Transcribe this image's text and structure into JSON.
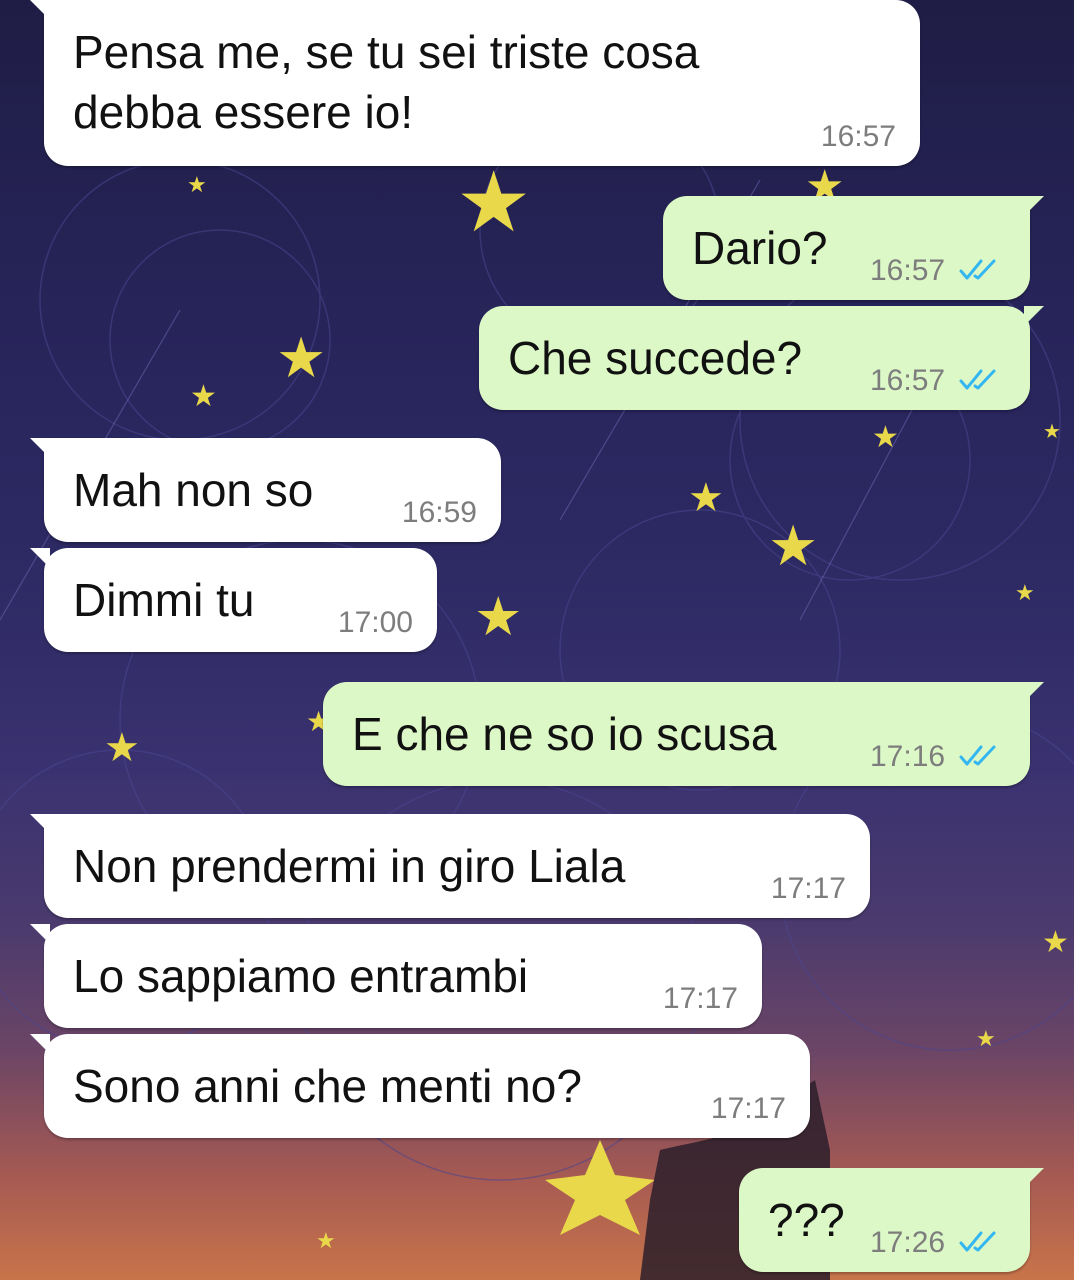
{
  "messages": [
    {
      "direction": "in",
      "text": "Pensa me, se tu sei triste cosa\ndebba essere io!",
      "time": "16:57"
    },
    {
      "direction": "out",
      "text": "Dario?",
      "time": "16:57",
      "status": "read"
    },
    {
      "direction": "out",
      "text": "Che succede?",
      "time": "16:57",
      "status": "read"
    },
    {
      "direction": "in",
      "text": "Mah non so",
      "time": "16:59"
    },
    {
      "direction": "in",
      "text": "Dimmi tu",
      "time": "17:00"
    },
    {
      "direction": "out",
      "text": "E che ne so io scusa",
      "time": "17:16",
      "status": "read"
    },
    {
      "direction": "in",
      "text": "Non prendermi in giro Liala",
      "time": "17:17"
    },
    {
      "direction": "in",
      "text": "Lo sappiamo entrambi",
      "time": "17:17"
    },
    {
      "direction": "in",
      "text": "Sono anni che menti no?",
      "time": "17:17"
    },
    {
      "direction": "out",
      "text": "???",
      "time": "17:26",
      "status": "read"
    }
  ],
  "colors": {
    "incoming_bubble": "#ffffff",
    "outgoing_bubble": "#dcf8c6",
    "read_ticks": "#34b7f1"
  },
  "icons": {
    "read_receipt": "double-check-icon",
    "wallpaper_star": "star-icon"
  }
}
